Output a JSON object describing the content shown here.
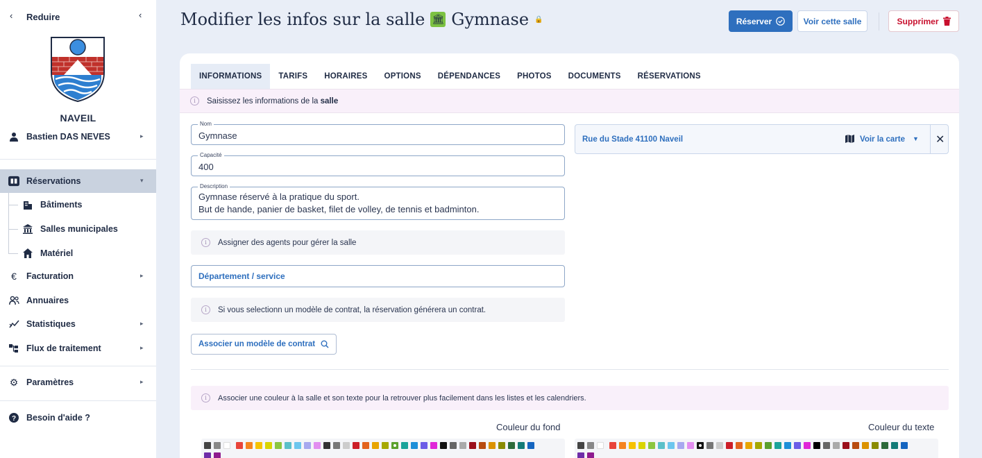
{
  "sidebar": {
    "collapse_label": "Reduire",
    "town": "NAVEIL",
    "user": "Bastien DAS NEVES",
    "items": [
      {
        "label": "Réservations"
      },
      {
        "label": "Bâtiments"
      },
      {
        "label": "Salles municipales"
      },
      {
        "label": "Matériel"
      },
      {
        "label": "Facturation"
      },
      {
        "label": "Annuaires"
      },
      {
        "label": "Statistiques"
      },
      {
        "label": "Flux de traitement"
      },
      {
        "label": "Paramètres"
      },
      {
        "label": "Besoin d'aide ?"
      }
    ]
  },
  "header": {
    "title": "Modifier les infos sur la salle",
    "room_name": "Gymnase",
    "reserve_label": "Réserver",
    "view_label": "Voir cette salle",
    "delete_label": "Supprimer"
  },
  "tabs": [
    "INFORMATIONS",
    "TARIFS",
    "HORAIRES",
    "OPTIONS",
    "DÉPENDANCES",
    "PHOTOS",
    "DOCUMENTS",
    "RÉSERVATIONS"
  ],
  "active_tab": "INFORMATIONS",
  "info_banner": {
    "text": "Saisissez les informations de la",
    "bold": "salle"
  },
  "form": {
    "name_label": "Nom",
    "name_value": "Gymnase",
    "capacity_label": "Capacité",
    "capacity_value": "400",
    "description_label": "Description",
    "description_line1": "Gymnase réservé à la pratique du sport.",
    "description_line2": "But de hande, panier de basket, filet de volley, de tennis et badminton."
  },
  "agents_note": "Assigner des agents pour gérer la salle",
  "department_label": "Département / service",
  "contract_note": "Si vous selectionn un modèle de contrat, la réservation générera un contrat.",
  "contract_button": "Associer un modèle de contrat",
  "address": {
    "text": "Rue du Stade 41100 Naveil",
    "map_label": "Voir la carte"
  },
  "color_note": "Associer une couleur à la salle et son texte pour la retrouver plus facilement dans les listes et les calendriers.",
  "background_color_label": "Couleur du fond",
  "text_color_label": "Couleur du texte",
  "colors": {
    "accent": "#2e6fbe",
    "danger": "#c8102e",
    "sidebar_active": "#c9d2df",
    "room_icon_bg": "#7cc242"
  },
  "palette_background": [
    "#444444",
    "#888888",
    "#ffffff",
    "#e8443a",
    "#f5841f",
    "#f6c200",
    "#d9d400",
    "#8cc63f",
    "#5ac0c9",
    "#6cc6ee",
    "#a7a8ef",
    "#e28ef0",
    "#333333",
    "#777777",
    "#cccccc",
    "#cc1e28",
    "#e3641e",
    "#e8a500",
    "#a6a800",
    "#5aa02c",
    "#1aa39a",
    "#1d8fd8",
    "#6c5ce7",
    "#e026d8",
    "#111111",
    "#666666",
    "#aaaaaa",
    "#9b0f1b",
    "#b84c10",
    "#db9200",
    "#8a8b00",
    "#2d6a3a",
    "#137b77",
    "#1565c0",
    "#6f2da8",
    "#8e1b8e"
  ],
  "palette_background_selected": 19,
  "palette_text": [
    "#444444",
    "#888888",
    "#ffffff",
    "#e8443a",
    "#f5841f",
    "#f6c200",
    "#d9d400",
    "#8cc63f",
    "#5ac0c9",
    "#6cc6ee",
    "#a7a8ef",
    "#e28ef0",
    "#111111",
    "#777777",
    "#cccccc",
    "#cc1e28",
    "#e3641e",
    "#e8a500",
    "#a6a800",
    "#5aa02c",
    "#1aa39a",
    "#1d8fd8",
    "#6c5ce7",
    "#e026d8",
    "#000000",
    "#666666",
    "#aaaaaa",
    "#9b0f1b",
    "#b84c10",
    "#db9200",
    "#8a8b00",
    "#2d6a3a",
    "#137b77",
    "#1565c0",
    "#6f2da8",
    "#8e1b8e"
  ],
  "palette_text_selected": 12
}
